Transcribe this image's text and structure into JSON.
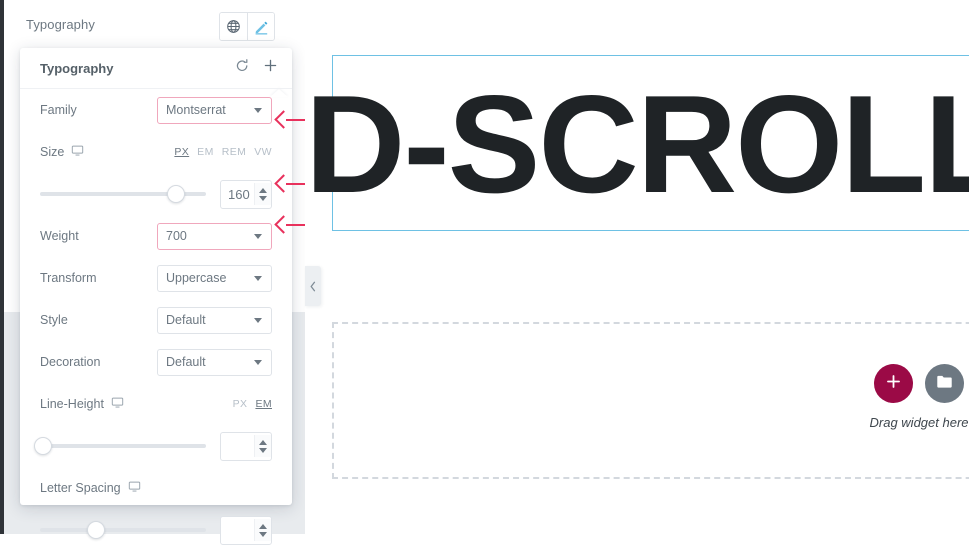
{
  "control_row": {
    "label": "Typography",
    "globe_icon": "globe-icon",
    "edit_icon": "pencil-icon"
  },
  "popover": {
    "title": "Typography",
    "reset_icon": "reset-arrow-icon",
    "add_icon": "plus-icon",
    "rows": {
      "family": {
        "label": "Family",
        "value": "Montserrat"
      },
      "size": {
        "label": "Size",
        "responsive_icon": "monitor-icon",
        "units": [
          "PX",
          "EM",
          "REM",
          "VW"
        ],
        "active_unit": "PX",
        "value": "160",
        "slider_percent": 79
      },
      "weight": {
        "label": "Weight",
        "value": "700"
      },
      "transform": {
        "label": "Transform",
        "value": "Uppercase"
      },
      "style": {
        "label": "Style",
        "value": "Default"
      },
      "decoration": {
        "label": "Decoration",
        "value": "Default"
      },
      "line_height": {
        "label": "Line-Height",
        "responsive_icon": "monitor-icon",
        "units": [
          "PX",
          "EM"
        ],
        "active_unit": "EM",
        "value": "",
        "slider_percent": 0
      },
      "letter_spacing": {
        "label": "Letter Spacing",
        "responsive_icon": "monitor-icon",
        "value": "",
        "slider_percent": 33
      }
    }
  },
  "annotations": {
    "color": "#e8315c",
    "items": [
      {
        "target": "family-select"
      },
      {
        "target": "size-number-input"
      },
      {
        "target": "weight-select"
      }
    ]
  },
  "canvas": {
    "heading_text": "D-SCROLL",
    "dropzone": {
      "label": "Drag widget here",
      "add_button_icon": "plus-icon",
      "add_button_color": "#9b0a46",
      "folder_button_icon": "folder-icon",
      "folder_button_color": "#6d7882"
    },
    "collapse_handle_icon": "chevron-left-icon"
  }
}
